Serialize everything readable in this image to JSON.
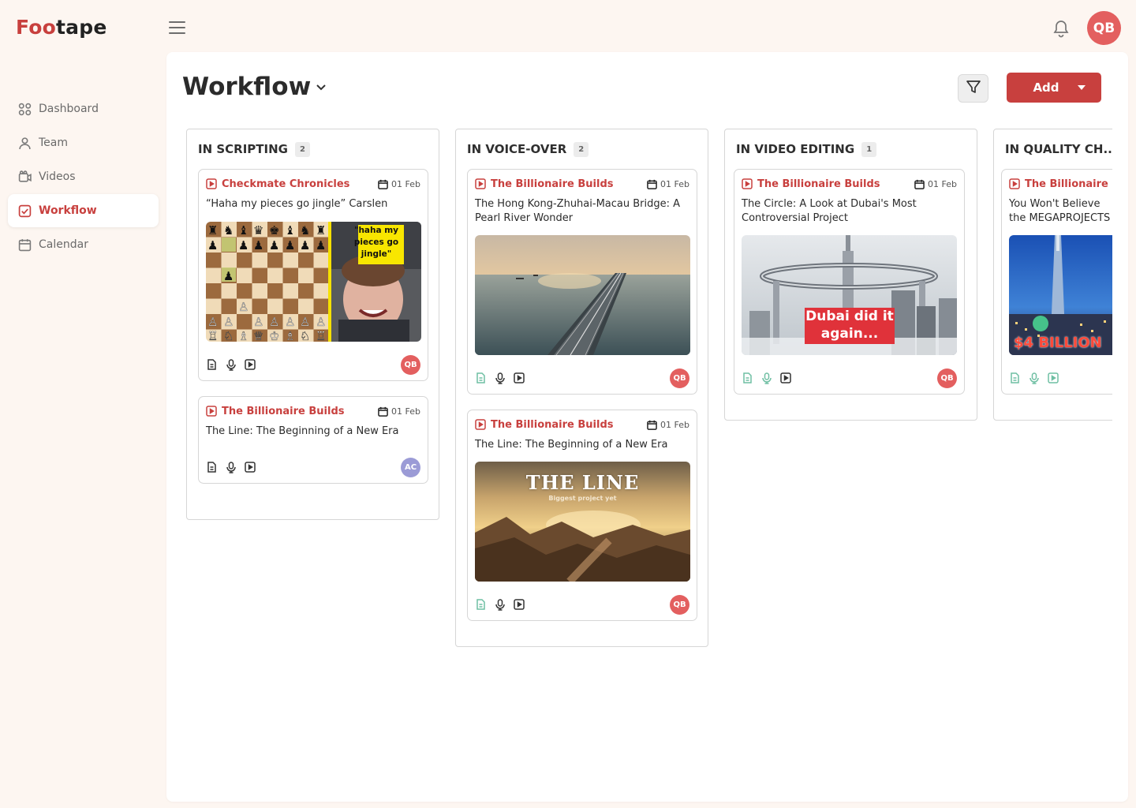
{
  "app": {
    "brand_part1": "Foo",
    "brand_part2": "tape",
    "brand_color": "#c8403e",
    "user_initials": "QB"
  },
  "sidebar": {
    "items": [
      {
        "label": "Dashboard",
        "icon": "dashboard-grid-icon",
        "active": false
      },
      {
        "label": "Team",
        "icon": "team-icon",
        "active": false
      },
      {
        "label": "Videos",
        "icon": "video-camera-icon",
        "active": false
      },
      {
        "label": "Workflow",
        "icon": "checkbox-icon",
        "active": true
      },
      {
        "label": "Calendar",
        "icon": "calendar-icon",
        "active": false
      }
    ]
  },
  "header": {
    "title": "Workflow",
    "add_label": "Add"
  },
  "columns": [
    {
      "title": "IN SCRIPTING",
      "count": "2",
      "cards": [
        {
          "channel": "Checkmate Chronicles",
          "date": "01 Feb",
          "title": "“Haha my pieces go jingle” Carslen",
          "thumbnail": "chess",
          "thumb_text": "\"haha my pieces go jingle\"",
          "stages": [
            "pending",
            "pending",
            "pending"
          ],
          "assignee": "QB"
        },
        {
          "channel": "The Billionaire Builds",
          "date": "01 Feb",
          "title": "The Line: The Beginning of a New Era",
          "thumbnail": "",
          "stages": [
            "pending",
            "pending",
            "pending"
          ],
          "assignee": "AC"
        }
      ]
    },
    {
      "title": "IN VOICE-OVER",
      "count": "2",
      "cards": [
        {
          "channel": "The Billionaire Builds",
          "date": "01 Feb",
          "title": "The Hong Kong-Zhuhai-Macau Bridge: A Pearl River Wonder",
          "thumbnail": "bridge",
          "stages": [
            "done",
            "pending",
            "pending"
          ],
          "assignee": "QB"
        },
        {
          "channel": "The Billionaire Builds",
          "date": "01 Feb",
          "title": "The Line: The Beginning of a New Era",
          "thumbnail": "desert",
          "thumb_text": "THE LINE",
          "thumb_subtext": "Biggest project yet",
          "stages": [
            "done",
            "pending",
            "pending"
          ],
          "assignee": "QB"
        }
      ]
    },
    {
      "title": "IN VIDEO EDITING",
      "count": "1",
      "cards": [
        {
          "channel": "The Billionaire Builds",
          "date": "01 Feb",
          "title": "The Circle: A Look at Dubai's Most Controversial Project",
          "thumbnail": "dubai",
          "thumb_text": "Dubai did it again...",
          "stages": [
            "done",
            "done",
            "pending"
          ],
          "assignee": "QB"
        }
      ]
    },
    {
      "title": "IN QUALITY CH...",
      "count": "",
      "cards": [
        {
          "channel": "The Billionaire Builds",
          "date": "",
          "title": "You Won't Believe the MEGAPROJECTS",
          "thumbnail": "city",
          "thumb_text": "$4 BILLION",
          "stages": [
            "done",
            "done",
            "done"
          ],
          "assignee": ""
        }
      ]
    }
  ],
  "colors": {
    "accent": "#c8403e",
    "done_stage": "#6fbfa3",
    "pending_stage": "#333333",
    "avatar_qb": "#e35f5f",
    "avatar_ac": "#9b9bd6"
  }
}
